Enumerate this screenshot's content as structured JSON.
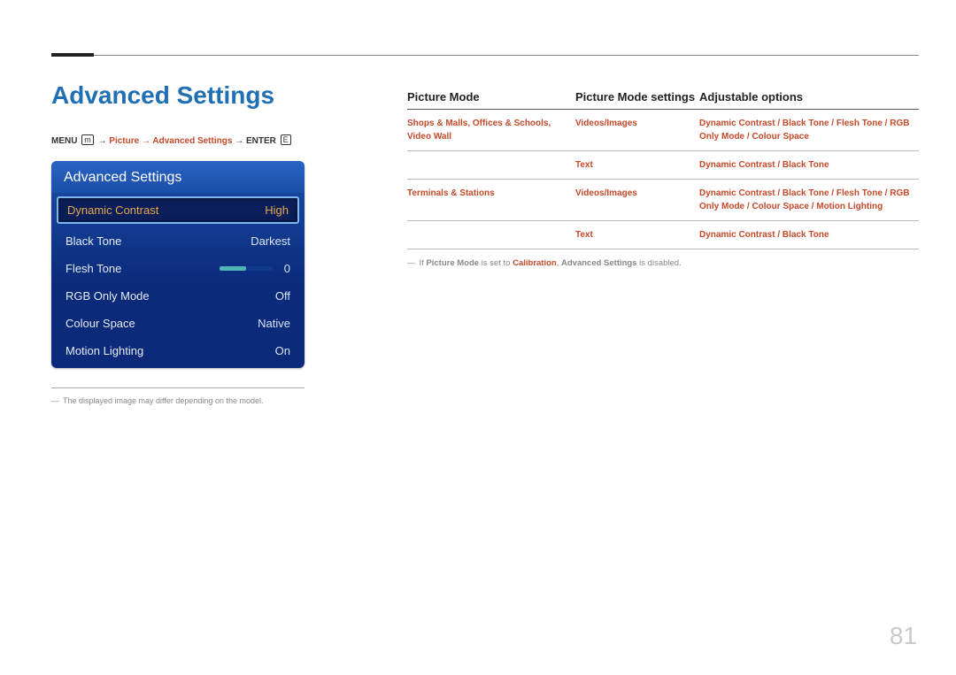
{
  "heading": "Advanced Settings",
  "breadcrumb": {
    "menu": "MENU",
    "path": "Picture → Advanced Settings",
    "enter": "ENTER",
    "arrow": "→"
  },
  "osd": {
    "title": "Advanced Settings",
    "items": [
      {
        "label": "Dynamic Contrast",
        "value": "High",
        "selected": true
      },
      {
        "label": "Black Tone",
        "value": "Darkest"
      },
      {
        "label": "Flesh Tone",
        "value": "0",
        "slider": true
      },
      {
        "label": "RGB Only Mode",
        "value": "Off"
      },
      {
        "label": "Colour Space",
        "value": "Native"
      },
      {
        "label": "Motion Lighting",
        "value": "On"
      }
    ]
  },
  "note1": "The displayed image may differ depending on the model.",
  "table": {
    "headers": {
      "mode": "Picture Mode",
      "settings": "Picture Mode settings",
      "options": "Adjustable options"
    },
    "rows": [
      {
        "mode": "Shops & Malls, Offices & Schools, Video Wall",
        "settings": "Videos/Images",
        "options": "Dynamic Contrast / Black Tone / Flesh Tone / RGB Only Mode / Colour Space"
      },
      {
        "mode": "",
        "settings": "Text",
        "options": "Dynamic Contrast / Black Tone"
      },
      {
        "mode": "Terminals & Stations",
        "settings": "Videos/Images",
        "options": "Dynamic Contrast / Black Tone / Flesh Tone / RGB Only Mode / Colour Space / Motion Lighting"
      },
      {
        "mode": "",
        "settings": "Text",
        "options": "Dynamic Contrast / Black Tone"
      }
    ],
    "footnote": {
      "pre": "If ",
      "b1": "Picture Mode",
      "mid1": " is set to ",
      "hl": "Calibration",
      "mid2": ", ",
      "b2": "Advanced Settings",
      "post": " is disabled."
    }
  },
  "pageNumber": "81"
}
